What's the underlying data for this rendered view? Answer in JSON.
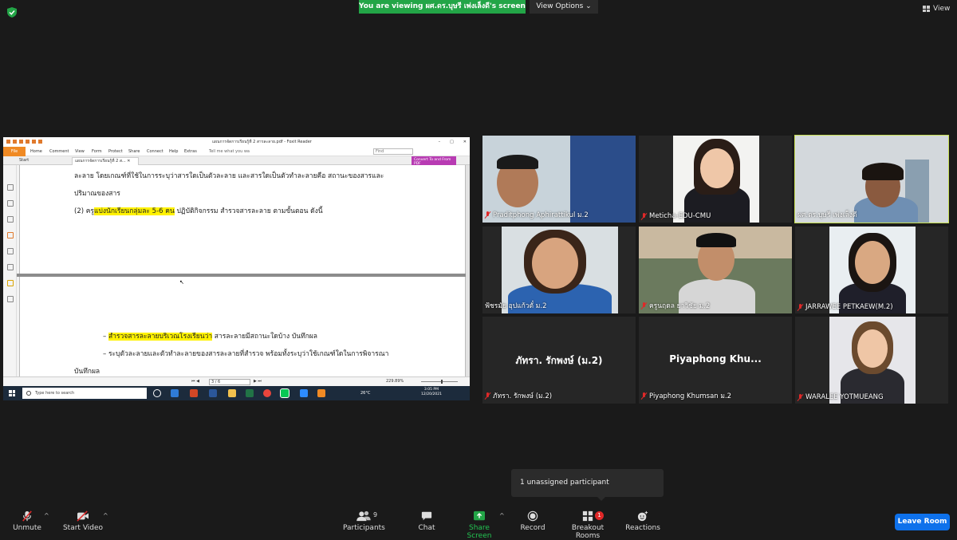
{
  "top_bar": {
    "viewing_banner": "You are viewing ผศ.ดร.บุษรี เพ่งเล็งดี's screen",
    "view_options": "View Options",
    "view_label": "View"
  },
  "shared_screen": {
    "window_title": "แผนการจัดการเรียนรู้ที่ 2 สารละลาย.pdf - Foxit Reader",
    "ribbon": {
      "file": "File",
      "tabs": [
        "Home",
        "Comment",
        "View",
        "Form",
        "Protect",
        "Share",
        "Connect",
        "Help",
        "Extras"
      ],
      "tell_me": "Tell me what you wa",
      "find_placeholder": "Find"
    },
    "doc_tabs": {
      "start": "Start",
      "current": "แผนการจัดการเรียนรู้ที่ 2 ส..."
    },
    "convert_button": "Convert To and From PDF",
    "page1_lines": [
      "ละลาย โดยเกณฑ์ที่ใช้ในการระบุว่าสารใดเป็นตัวละลาย และสารใดเป็นตัวทำละลายคือ สถานะของสารและ",
      "ปริมาณของสาร"
    ],
    "page1_line3": {
      "prefix": "(2) ครู",
      "highlight": "แบ่งนักเรียนกลุ่มละ 5-6 คน",
      "suffix": " ปฏิบัติกิจกรรม สำรวจสารละลาย ตามขั้นตอน ดังนี้"
    },
    "page2_bullet1": {
      "prefix": "– ",
      "highlight": "สำรวจสารละลายบริเวณโรงเรียนว่า",
      "suffix": " สารละลายมีสถานะใดบ้าง บันทึกผล"
    },
    "page2_bullet2": "– ระบุตัวละลายและตัวทำละลายของสารละลายที่สำรวจ พร้อมทั้งระบุว่าใช้เกณฑ์ใดในการพิจารณา",
    "page2_line3": "บันทึกผล",
    "status": {
      "page_field": "3 / 6",
      "zoom": "229.89%"
    },
    "taskbar": {
      "search": "Type here to search",
      "weather": "26°C",
      "time": "3:05 PM",
      "date": "12/20/2021"
    }
  },
  "participants": [
    {
      "name": "Praditphong Aphirattikul ม.2"
    },
    {
      "name": "Meticha-EDU-CMU"
    },
    {
      "name": "ผศ.ดร.บุษรี เพ่งเล็งดี"
    },
    {
      "name": "ฟ้ชรมัย อุปแก้วตั๋ ม.2"
    },
    {
      "name": "ครูนฤดล ยาวิชัย ม.2"
    },
    {
      "name": "JARRAWEE PETKAEW(M.2)"
    },
    {
      "name": "ภัทรา. รักพงษ์ (ม.2)",
      "display": "ภัทรา. รักพงษ์ (ม.2)"
    },
    {
      "name": "Piyaphong Khumsan ม.2",
      "display": "Piyaphong  Khu..."
    },
    {
      "name": "WARALEE YOTMUEANG"
    }
  ],
  "notice": "1 unassigned participant",
  "toolbar": {
    "unmute": "Unmute",
    "start_video": "Start Video",
    "participants": "Participants",
    "participants_count": "9",
    "chat": "Chat",
    "share_screen": "Share Screen",
    "record": "Record",
    "breakout_rooms": "Breakout Rooms",
    "breakout_badge": "1",
    "reactions": "Reactions",
    "leave": "Leave Room"
  },
  "colors": {
    "share_green": "#23a547",
    "leave_blue": "#0e71eb",
    "active_speaker": "#c8df53",
    "muted_red": "#e02828"
  }
}
